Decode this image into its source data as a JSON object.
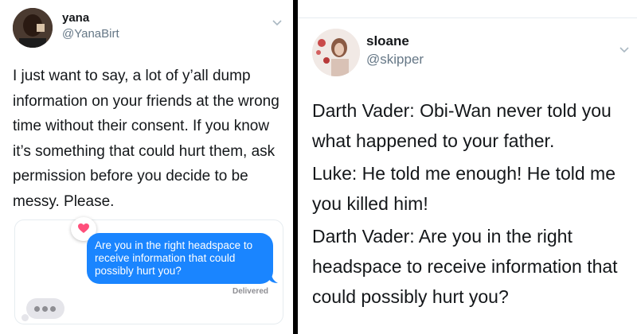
{
  "left_tweet": {
    "name": "yana",
    "handle": "@YanaBirt",
    "text": "I just want to say, a lot of y’all dump information on your friends at the wrong time without their consent. If you know it’s something that could hurt them, ask permission before you decide to be messy. Please.",
    "message_card": {
      "bubble_text": "Are you in the right headspace to receive information that could possibly hurt you?",
      "status": "Delivered",
      "reaction_icon": "heart-icon",
      "typing_icon": "typing-indicator"
    }
  },
  "right_tweet": {
    "name": "sloane",
    "handle": "@skipper",
    "lines": [
      "Darth Vader: Obi-Wan never told you what happened to your father.",
      "Luke: He told me enough! He told me you killed him!",
      "Darth Vader: Are you in the right headspace to receive information that could possibly hurt you?"
    ]
  },
  "colors": {
    "imessage_blue": "#1a85ff",
    "heart_pink": "#ff4f7b",
    "divider": "#000000",
    "muted_text": "#657786"
  }
}
